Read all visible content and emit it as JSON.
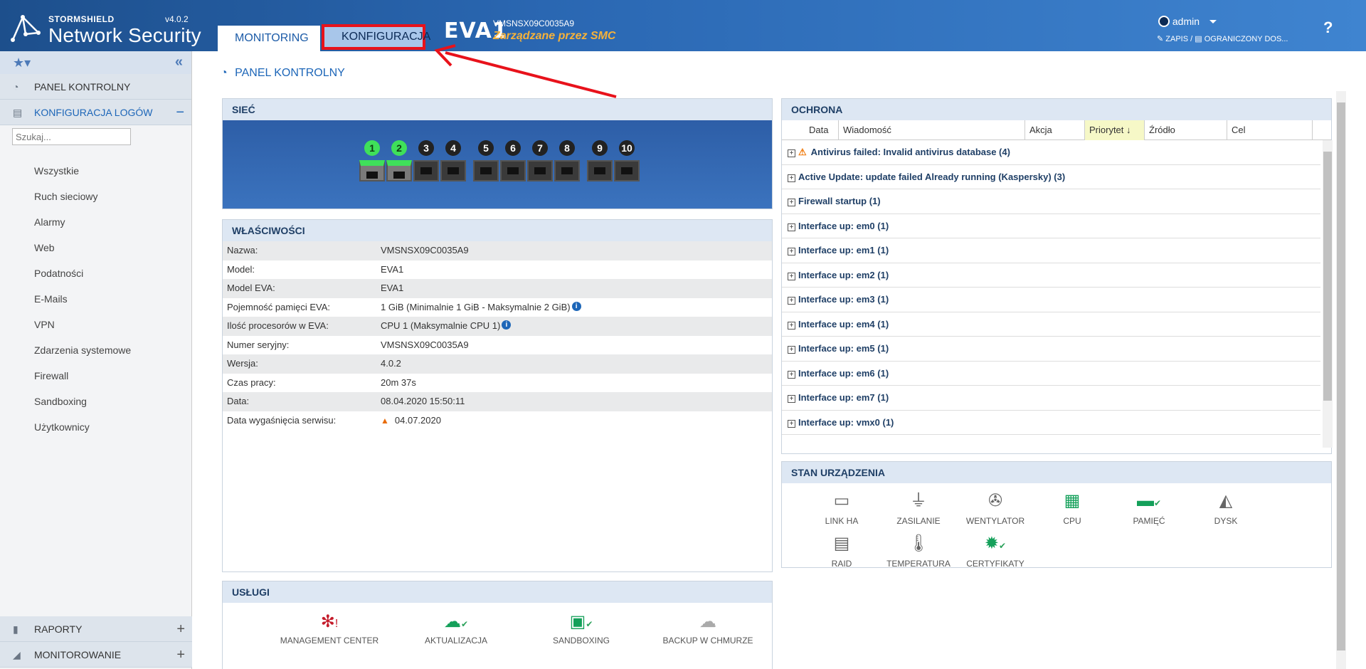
{
  "header": {
    "brand": "STORMSHIELD",
    "product": "Network Security",
    "version": "v4.0.2",
    "tabs": [
      {
        "label": "MONITORING"
      },
      {
        "label": "KONFIGURACJA"
      }
    ],
    "device_name": "EVA1",
    "device_serial": "VMSNSX09C0035A9",
    "device_managed": "Zarządzane przez SMC",
    "user": "admin",
    "mode_write": "ZAPIS /",
    "mode_access": "OGRANICZONY DOS...",
    "help": "?"
  },
  "sidebar": {
    "panel_label": "PANEL KONTROLNY",
    "logs_label": "KONFIGURACJA LOGÓW",
    "search_placeholder": "Szukaj...",
    "items": [
      "Wszystkie",
      "Ruch sieciowy",
      "Alarmy",
      "Web",
      "Podatności",
      "E-Mails",
      "VPN",
      "Zdarzenia systemowe",
      "Firewall",
      "Sandboxing",
      "Użytkownicy"
    ],
    "reports_label": "RAPORTY",
    "monitoring_label": "MONITOROWANIE"
  },
  "main": {
    "title": "PANEL KONTROLNY",
    "network": {
      "title": "SIEĆ",
      "ports": [
        {
          "num": "1",
          "on": true
        },
        {
          "num": "2",
          "on": true
        },
        {
          "num": "3",
          "on": false
        },
        {
          "num": "4",
          "on": false
        },
        {
          "num": "5",
          "on": false
        },
        {
          "num": "6",
          "on": false
        },
        {
          "num": "7",
          "on": false
        },
        {
          "num": "8",
          "on": false
        },
        {
          "num": "9",
          "on": false
        },
        {
          "num": "10",
          "on": false
        }
      ]
    },
    "properties": {
      "title": "WŁAŚCIWOŚCI",
      "rows": [
        {
          "label": "Nazwa:",
          "value": "VMSNSX09C0035A9"
        },
        {
          "label": "Model:",
          "value": "EVA1"
        },
        {
          "label": "Model EVA:",
          "value": "EVA1"
        },
        {
          "label": "Pojemność pamięci EVA:",
          "value": "1 GiB (Minimalnie 1 GiB - Maksymalnie 2 GiB)"
        },
        {
          "label": "Ilość procesorów w EVA:",
          "value": "CPU 1 (Maksymalnie CPU 1)"
        },
        {
          "label": "Numer seryjny:",
          "value": "VMSNSX09C0035A9"
        },
        {
          "label": "Wersja:",
          "value": "4.0.2"
        },
        {
          "label": "Czas pracy:",
          "value": "20m 37s"
        },
        {
          "label": "Data:",
          "value": "08.04.2020 15:50:11"
        },
        {
          "label": "Data wygaśnięcia serwisu:",
          "value": "04.07.2020"
        }
      ]
    },
    "protection": {
      "title": "OCHRONA",
      "columns": [
        "Data",
        "Wiadomość",
        "Akcja",
        "Priorytet",
        "Źródło",
        "Cel"
      ],
      "items": [
        "Antivirus failed: Invalid antivirus database (4)",
        "Active Update: update failed Already running (Kaspersky) (3)",
        "Firewall startup (1)",
        "Interface up: em0 (1)",
        "Interface up: em1 (1)",
        "Interface up: em2 (1)",
        "Interface up: em3 (1)",
        "Interface up: em4 (1)",
        "Interface up: em5 (1)",
        "Interface up: em6 (1)",
        "Interface up: em7 (1)",
        "Interface up: vmx0 (1)"
      ]
    },
    "device_status": {
      "title": "STAN URZĄDZENIA",
      "items": [
        "LINK HA",
        "ZASILANIE",
        "WENTYLATOR",
        "CPU",
        "PAMIĘĆ",
        "DYSK",
        "RAID",
        "TEMPERATURA",
        "CERTYFIKATY"
      ]
    },
    "services": {
      "title": "USŁUGI",
      "items": [
        "MANAGEMENT CENTER",
        "AKTUALIZACJA",
        "SANDBOXING",
        "BACKUP W CHMURZE"
      ]
    }
  },
  "colors": {
    "header_start": "#1d4f8c",
    "header_end": "#3f84d0",
    "accent": "#1d66b8",
    "highlight_box": "#e8121b",
    "managed": "#f6b23a",
    "port_on": "#3fe05a"
  }
}
